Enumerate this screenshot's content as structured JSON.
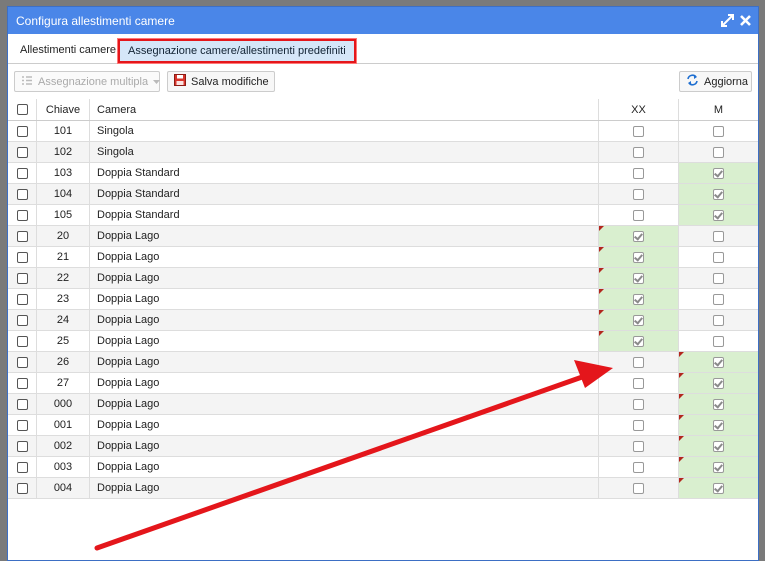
{
  "window": {
    "title": "Configura allestimenti camere"
  },
  "tabs": [
    {
      "label": "Allestimenti camere"
    },
    {
      "label": "Assegnazione camere/allestimenti predefiniti"
    }
  ],
  "toolbar": {
    "assign_label": "Assegnazione multipla",
    "save_label": "Salva modifiche",
    "refresh_label": "Aggiorna"
  },
  "grid": {
    "columns": {
      "key": "Chiave",
      "camera": "Camera",
      "xx": "XX",
      "m": "M"
    },
    "rows": [
      {
        "key": "101",
        "camera": "Singola",
        "xx": false,
        "m": false,
        "xx_dirty": false,
        "m_dirty": false
      },
      {
        "key": "102",
        "camera": "Singola",
        "xx": false,
        "m": false,
        "xx_dirty": false,
        "m_dirty": false
      },
      {
        "key": "103",
        "camera": "Doppia Standard",
        "xx": false,
        "m": true,
        "xx_dirty": false,
        "m_dirty": false
      },
      {
        "key": "104",
        "camera": "Doppia Standard",
        "xx": false,
        "m": true,
        "xx_dirty": false,
        "m_dirty": false
      },
      {
        "key": "105",
        "camera": "Doppia Standard",
        "xx": false,
        "m": true,
        "xx_dirty": false,
        "m_dirty": false
      },
      {
        "key": "20",
        "camera": "Doppia Lago",
        "xx": true,
        "m": false,
        "xx_dirty": true,
        "m_dirty": false
      },
      {
        "key": "21",
        "camera": "Doppia Lago",
        "xx": true,
        "m": false,
        "xx_dirty": true,
        "m_dirty": false
      },
      {
        "key": "22",
        "camera": "Doppia Lago",
        "xx": true,
        "m": false,
        "xx_dirty": true,
        "m_dirty": false
      },
      {
        "key": "23",
        "camera": "Doppia Lago",
        "xx": true,
        "m": false,
        "xx_dirty": true,
        "m_dirty": false
      },
      {
        "key": "24",
        "camera": "Doppia Lago",
        "xx": true,
        "m": false,
        "xx_dirty": true,
        "m_dirty": false
      },
      {
        "key": "25",
        "camera": "Doppia Lago",
        "xx": true,
        "m": false,
        "xx_dirty": true,
        "m_dirty": false
      },
      {
        "key": "26",
        "camera": "Doppia Lago",
        "xx": false,
        "m": true,
        "xx_dirty": false,
        "m_dirty": true
      },
      {
        "key": "27",
        "camera": "Doppia Lago",
        "xx": false,
        "m": true,
        "xx_dirty": false,
        "m_dirty": true
      },
      {
        "key": "000",
        "camera": "Doppia Lago",
        "xx": false,
        "m": true,
        "xx_dirty": false,
        "m_dirty": true
      },
      {
        "key": "001",
        "camera": "Doppia Lago",
        "xx": false,
        "m": true,
        "xx_dirty": false,
        "m_dirty": true
      },
      {
        "key": "002",
        "camera": "Doppia Lago",
        "xx": false,
        "m": true,
        "xx_dirty": false,
        "m_dirty": true
      },
      {
        "key": "003",
        "camera": "Doppia Lago",
        "xx": false,
        "m": true,
        "xx_dirty": false,
        "m_dirty": true
      },
      {
        "key": "004",
        "camera": "Doppia Lago",
        "xx": false,
        "m": true,
        "xx_dirty": false,
        "m_dirty": true
      }
    ]
  },
  "colors": {
    "titlebar": "#4a86e8",
    "selected_cell": "#d9efcf",
    "annotation_red": "#e4161b"
  },
  "icons": [
    "maximize-icon",
    "close-icon",
    "list-icon",
    "caret-down-icon",
    "floppy-disk-icon",
    "refresh-icon"
  ]
}
